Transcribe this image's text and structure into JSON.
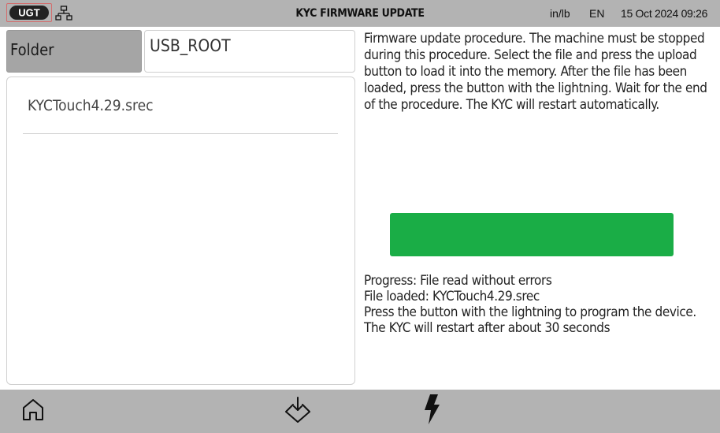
{
  "header": {
    "title": "KYC FIRMWARE UPDATE",
    "units": "in/lb",
    "language": "EN",
    "datetime": "15 Oct 2024 09:26",
    "logo_icon": "ugt-logo",
    "network_icon": "network-icon"
  },
  "left_panel": {
    "folder_label": "Folder",
    "folder_value": "USB_ROOT",
    "files": [
      {
        "name": "KYCTouch4.29.srec"
      }
    ]
  },
  "right_panel": {
    "instructions": "Firmware update procedure. The machine must be stopped during this procedure. Select the file and press the upload button to load it into the memory. After the file has been loaded, press the button with the lightning. Wait for the end of the procedure. The KYC will restart automatically.",
    "progress_fraction": 1.0,
    "progress_color": "#1aad46",
    "status_lines": [
      "Progress: File read without errors",
      "File loaded: KYCTouch4.29.srec",
      "Press the button with the lightning to program the device.",
      "The KYC will restart after about 30 seconds"
    ]
  },
  "footer": {
    "buttons": [
      {
        "icon": "home-icon"
      },
      {
        "icon": "upload-icon"
      },
      {
        "icon": "lightning-icon"
      }
    ]
  }
}
